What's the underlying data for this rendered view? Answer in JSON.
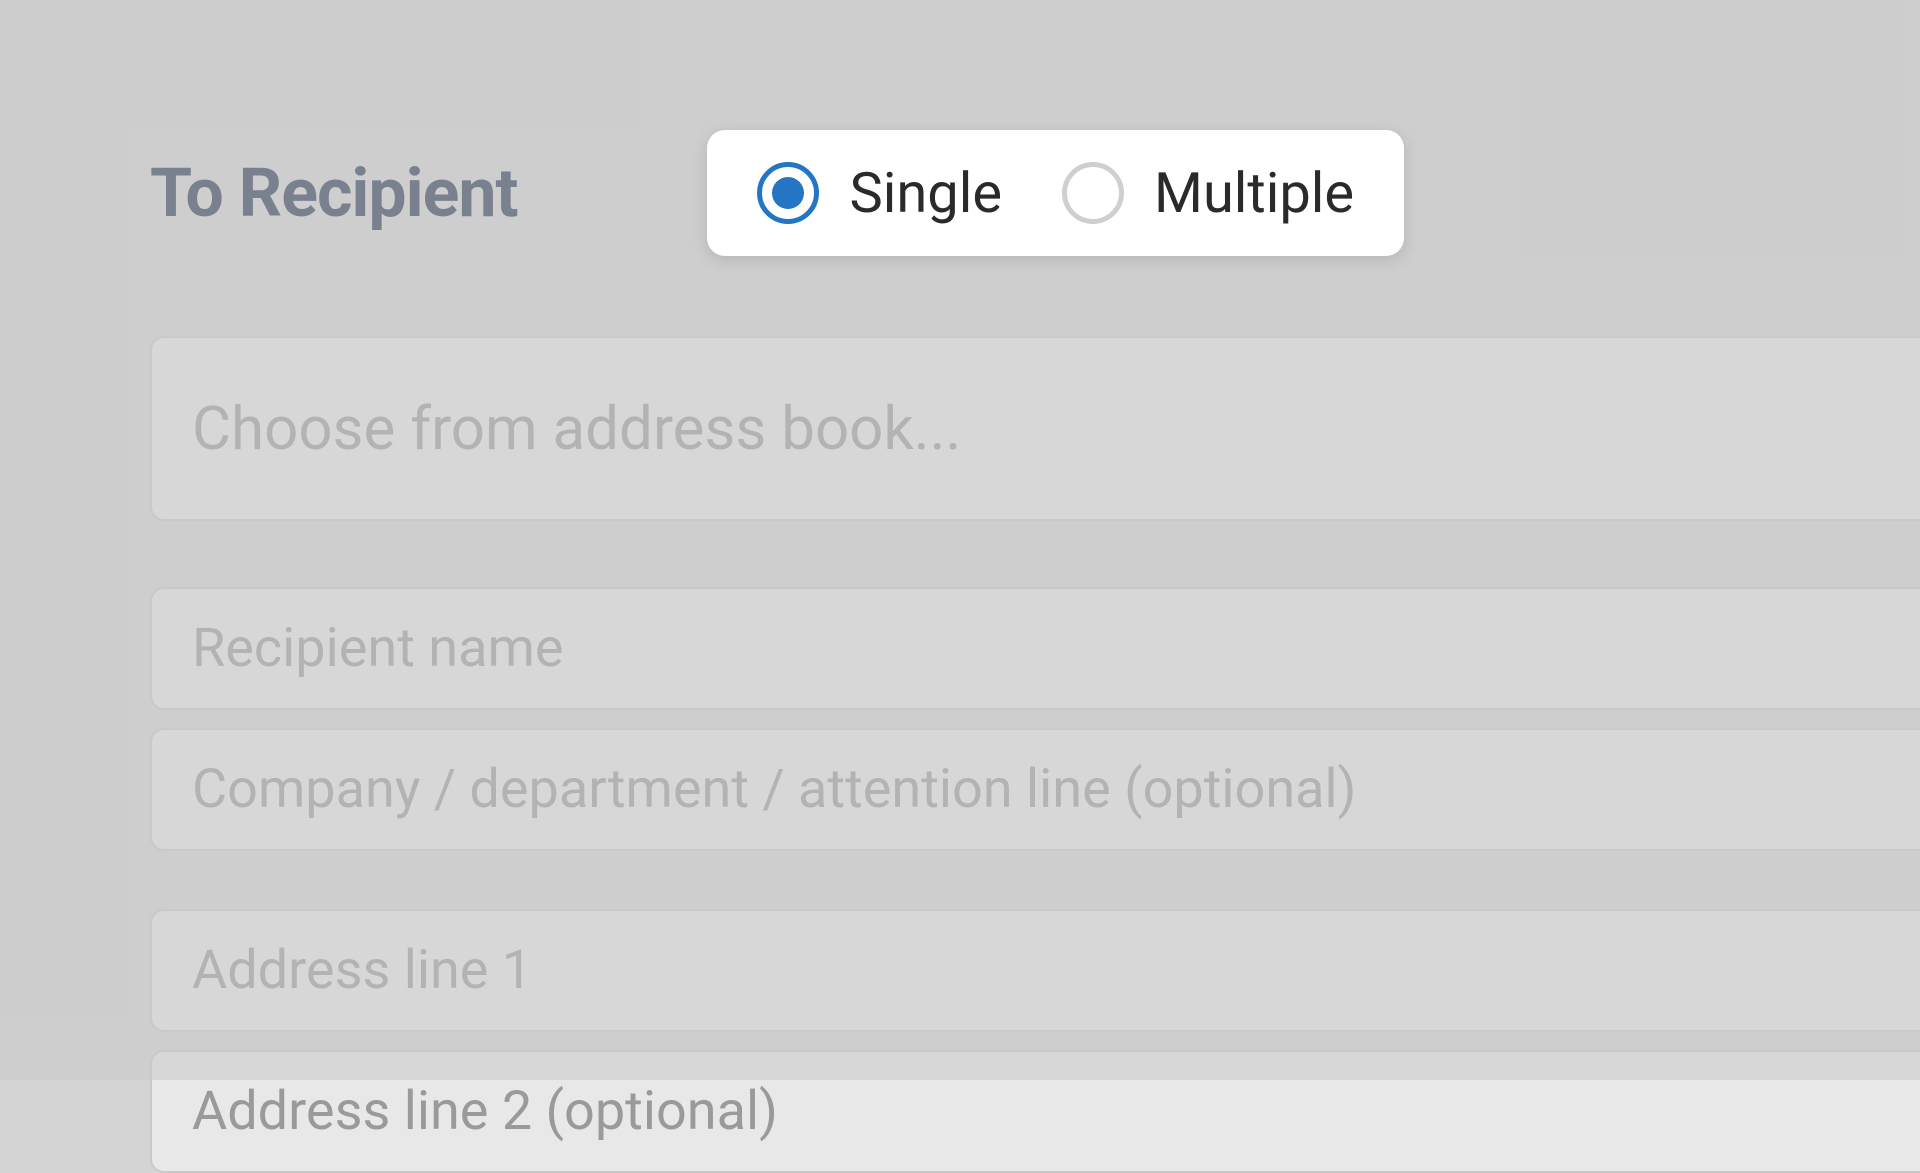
{
  "section": {
    "title": "To Recipient"
  },
  "recipientMode": {
    "single": {
      "label": "Single",
      "selected": true
    },
    "multiple": {
      "label": "Multiple",
      "selected": false
    }
  },
  "fields": {
    "addressBook": {
      "placeholder": "Choose from address book..."
    },
    "recipientName": {
      "placeholder": "Recipient name"
    },
    "company": {
      "placeholder": "Company / department / attention line (optional)"
    },
    "addressLine1": {
      "placeholder": "Address line 1"
    },
    "addressLine2": {
      "placeholder": "Address line 2 (optional)"
    }
  }
}
